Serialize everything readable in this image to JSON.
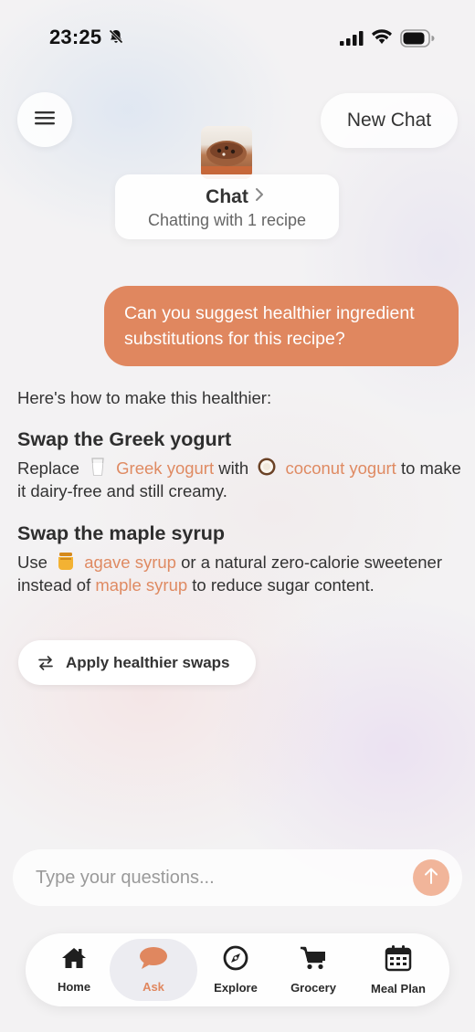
{
  "status_bar": {
    "time": "23:25"
  },
  "header": {
    "new_chat_label": "New Chat",
    "chat_title": "Chat",
    "chat_subtitle": "Chatting with 1 recipe"
  },
  "user_message": "Can you suggest healthier ingredient substitutions for this recipe?",
  "answer": {
    "intro": "Here's how to make this healthier:",
    "sections": [
      {
        "heading": "Swap the Greek yogurt",
        "t1": "Replace",
        "ing1": "Greek yogurt",
        "t2": "with",
        "ing2": "coconut yogurt",
        "t3": "to make it dairy-free and still creamy."
      },
      {
        "heading": "Swap the maple syrup",
        "t1": "Use",
        "ing1": "agave syrup",
        "t2": "or a natural zero-calorie sweetener instead of",
        "ing2": "maple syrup",
        "t3": "to reduce sugar content."
      }
    ],
    "action_label": "Apply healthier swaps"
  },
  "composer": {
    "placeholder": "Type your questions..."
  },
  "tabs": [
    {
      "label": "Home",
      "icon": "home-icon"
    },
    {
      "label": "Ask",
      "icon": "chat-bubble-icon",
      "active": true
    },
    {
      "label": "Explore",
      "icon": "compass-icon"
    },
    {
      "label": "Grocery",
      "icon": "cart-icon"
    },
    {
      "label": "Meal Plan",
      "icon": "calendar-icon"
    }
  ],
  "colors": {
    "accent": "#e0875f",
    "highlight": "#df8a62",
    "send_button": "#f1b59a"
  }
}
